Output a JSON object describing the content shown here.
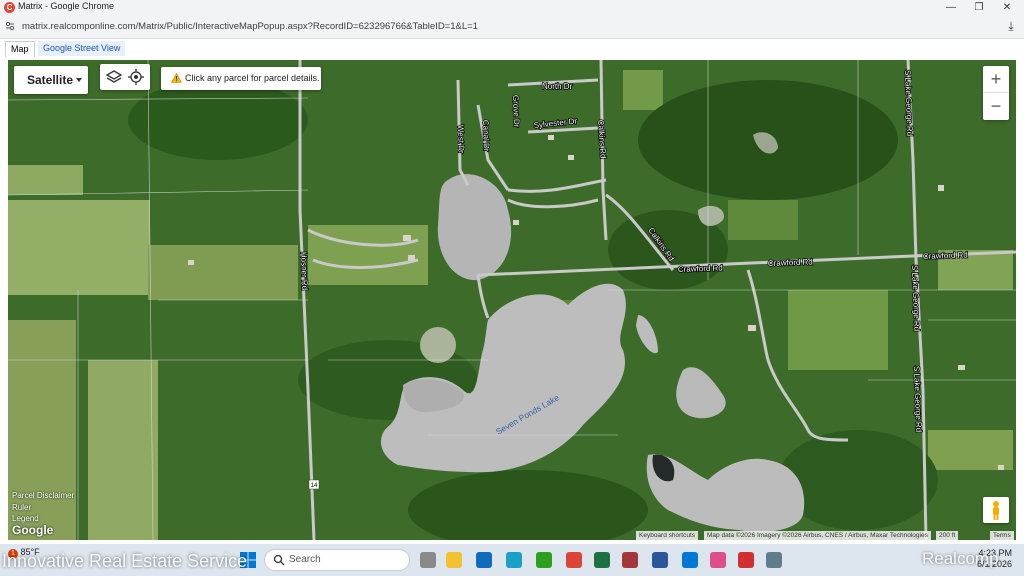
{
  "window": {
    "title": "Matrix - Google Chrome",
    "minimize": "—",
    "restore": "❐",
    "close": "✕"
  },
  "browser": {
    "url": "matrix.realcomponline.com/Matrix/Public/InteractiveMapPopup.aspx?RecordID=623296766&TableID=1&L=1",
    "download_icon": "⤓"
  },
  "tabs": [
    {
      "label": "Map",
      "active": true
    },
    {
      "label": "Google Street View",
      "active": false
    }
  ],
  "map": {
    "map_type": "Satellite",
    "notice": "Click any parcel for parcel details.",
    "zoom_in": "+",
    "zoom_out": "−",
    "road_labels": {
      "north_dr": "North Dr",
      "sylvester_dr": "Sylvester Dr",
      "calkins_rd_1": "Calkins Rd",
      "calkins_rd_2": "Calkins Rd",
      "crawford_rd_1": "Crawford Rd",
      "crawford_rd_2": "Crawford Rd",
      "crawford_rd_3": "Crawford Rd",
      "hosner_rd": "Hosner Rd",
      "s_lake_george_rd_1": "S Lake George Rd",
      "s_lake_george_rd_2": "S Lake George Rd",
      "s_lake_george_rd_3": "S Lake George Rd",
      "grove_dr": "Grove Dr",
      "canal_dr": "Canal Dr",
      "west_dr": "West Dr",
      "lake": "Seven Ponds Lake",
      "route": "14"
    },
    "legend_links": {
      "disclaimer": "Parcel Disclaimer",
      "ruler": "Ruler",
      "legend": "Legend"
    },
    "logo": "Google",
    "attribution": {
      "shortcuts": "Keyboard shortcuts",
      "data": "Map data ©2026 Imagery ©2026 Airbus, CNES / Airbus, Maxar Technologies",
      "scale": "200 ft",
      "terms": "Terms"
    }
  },
  "taskbar": {
    "weather_badge": "1",
    "temperature": "85°F",
    "search_placeholder": "Search",
    "time": "4:23 PM",
    "date": "6/1/2026"
  },
  "watermarks": {
    "left": "Innovative Real Estate Service",
    "right": "Realcomp"
  },
  "colors": {
    "accent": "#1a73e8",
    "forest": "#2f5e22",
    "field": "#86a35a",
    "water": "#b7b7b7",
    "road": "#c8c8c8"
  }
}
